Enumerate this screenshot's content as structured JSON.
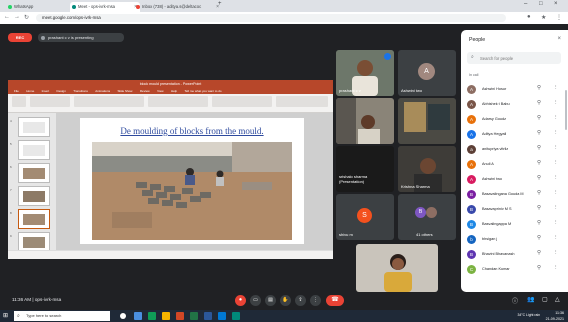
{
  "browser": {
    "tabs": [
      {
        "label": "WhatsApp",
        "color": "#25d366"
      },
      {
        "label": "Meet - ops-ivrk-msa",
        "color": "#00897b"
      },
      {
        "label": "Inbox (738) - aditya.s@deltacoc",
        "color": "#ea4335"
      }
    ],
    "url": "meet.google.com/ops-ivrk-msa"
  },
  "meet_header": {
    "rec_label": "REC",
    "presenting_text": "prashant c v is presenting"
  },
  "ppt": {
    "window_title": "block mould presentation - PowerPoint",
    "menu": [
      "File",
      "Home",
      "Insert",
      "Design",
      "Transitions",
      "Animations",
      "Slide Show",
      "Review",
      "View",
      "Help",
      "Tell me what you want to do"
    ],
    "slide_title": "De moulding of blocks from the mould.",
    "slide_numbers": [
      "4",
      "5",
      "6",
      "7",
      "8",
      "9"
    ]
  },
  "tiles": [
    {
      "name": "prashant c v"
    },
    {
      "name": "Ashwini two",
      "initial": "A"
    },
    {
      "name": ""
    },
    {
      "name": ""
    },
    {
      "name": "srishalo sharma (Presentation)"
    },
    {
      "name": "Krishna Sharma"
    },
    {
      "name": "shivu m",
      "initial": "S"
    },
    {
      "name": "41 others",
      "initial": "B"
    },
    {
      "name": ""
    }
  ],
  "people_panel": {
    "title": "People",
    "search_placeholder": "Search for people",
    "section_label": "In call",
    "people": [
      {
        "name": "Ashwini Hosur",
        "initial": "A",
        "color": "#8d6e63"
      },
      {
        "name": "Abhishek t Babu",
        "initial": "A",
        "color": "#795548"
      },
      {
        "name": "Adarsy Goudz",
        "initial": "A",
        "color": "#e8710a"
      },
      {
        "name": "Aditya Hegyall",
        "initial": "A",
        "color": "#1a73e8"
      },
      {
        "name": "anitupriya vitrilz",
        "initial": "a",
        "color": "#5d4037"
      },
      {
        "name": "Anuli A",
        "initial": "A",
        "color": "#e8710a"
      },
      {
        "name": "Ashwini two",
        "initial": "A",
        "color": "#d81b60"
      },
      {
        "name": "Basavalingana Gouda M",
        "initial": "B",
        "color": "#7b1fa2"
      },
      {
        "name": "Basavapriniv M S",
        "initial": "B",
        "color": "#3949ab"
      },
      {
        "name": "Basvalingappa M",
        "initial": "B",
        "color": "#1e88e5"
      },
      {
        "name": "bhsigan j",
        "initial": "b",
        "color": "#1565c0"
      },
      {
        "name": "Bhavini Bhavanash",
        "initial": "B",
        "color": "#5e35b1"
      },
      {
        "name": "Chandan Kumar",
        "initial": "C",
        "color": "#7cb342"
      }
    ]
  },
  "bottom": {
    "meeting_time": "11:36 AM",
    "meeting_code": "ops-ivrk-msa"
  },
  "taskbar": {
    "search_text": "Type here to search",
    "status": "34°C Light rain",
    "time": "11:36",
    "date": "21-09-2021"
  }
}
